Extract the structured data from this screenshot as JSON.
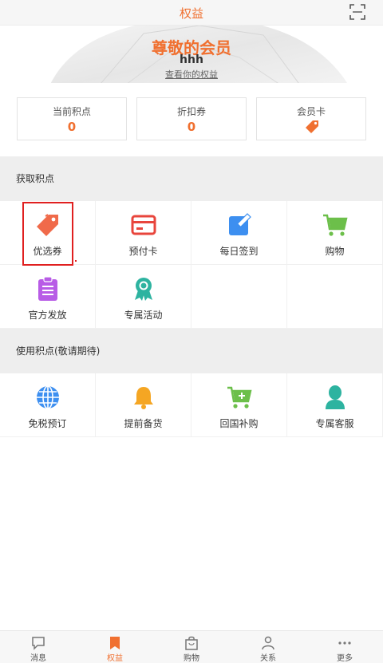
{
  "header": {
    "title": "权益"
  },
  "hero": {
    "title": "尊敬的会员",
    "username": "hhh",
    "link_label": "查看你的权益"
  },
  "stats": [
    {
      "label": "当前积点",
      "value": "0"
    },
    {
      "label": "折扣券",
      "value": "0"
    },
    {
      "label": "会员卡",
      "icon": "tag-icon"
    }
  ],
  "earn": {
    "title": "获取积点",
    "items": [
      {
        "label": "优选券",
        "icon": "coupon-tag-icon",
        "color": "#f06a4a"
      },
      {
        "label": "预付卡",
        "icon": "card-icon",
        "color": "#e8453c"
      },
      {
        "label": "每日签到",
        "icon": "edit-icon",
        "color": "#3d8ff0"
      },
      {
        "label": "购物",
        "icon": "cart-icon",
        "color": "#6cbf4a"
      },
      {
        "label": "官方发放",
        "icon": "clipboard-icon",
        "color": "#b85ce6"
      },
      {
        "label": "专属活动",
        "icon": "ribbon-icon",
        "color": "#2db3a0"
      }
    ]
  },
  "use": {
    "title": "使用积点(敬请期待)",
    "items": [
      {
        "label": "免税预订",
        "icon": "globe-icon",
        "color": "#3d8ff0"
      },
      {
        "label": "提前备货",
        "icon": "bell-icon",
        "color": "#f5a623"
      },
      {
        "label": "回国补购",
        "icon": "cart-add-icon",
        "color": "#6cbf4a"
      },
      {
        "label": "专属客服",
        "icon": "person-icon",
        "color": "#2db3a0"
      }
    ]
  },
  "tabs": [
    {
      "label": "消息",
      "icon": "message-icon"
    },
    {
      "label": "权益",
      "icon": "bookmark-icon",
      "active": true
    },
    {
      "label": "购物",
      "icon": "bag-icon"
    },
    {
      "label": "关系",
      "icon": "relation-icon"
    },
    {
      "label": "更多",
      "icon": "more-icon"
    }
  ],
  "colors": {
    "accent": "#f07030",
    "section_bg": "#eeeeee",
    "highlight": "#e02020"
  }
}
